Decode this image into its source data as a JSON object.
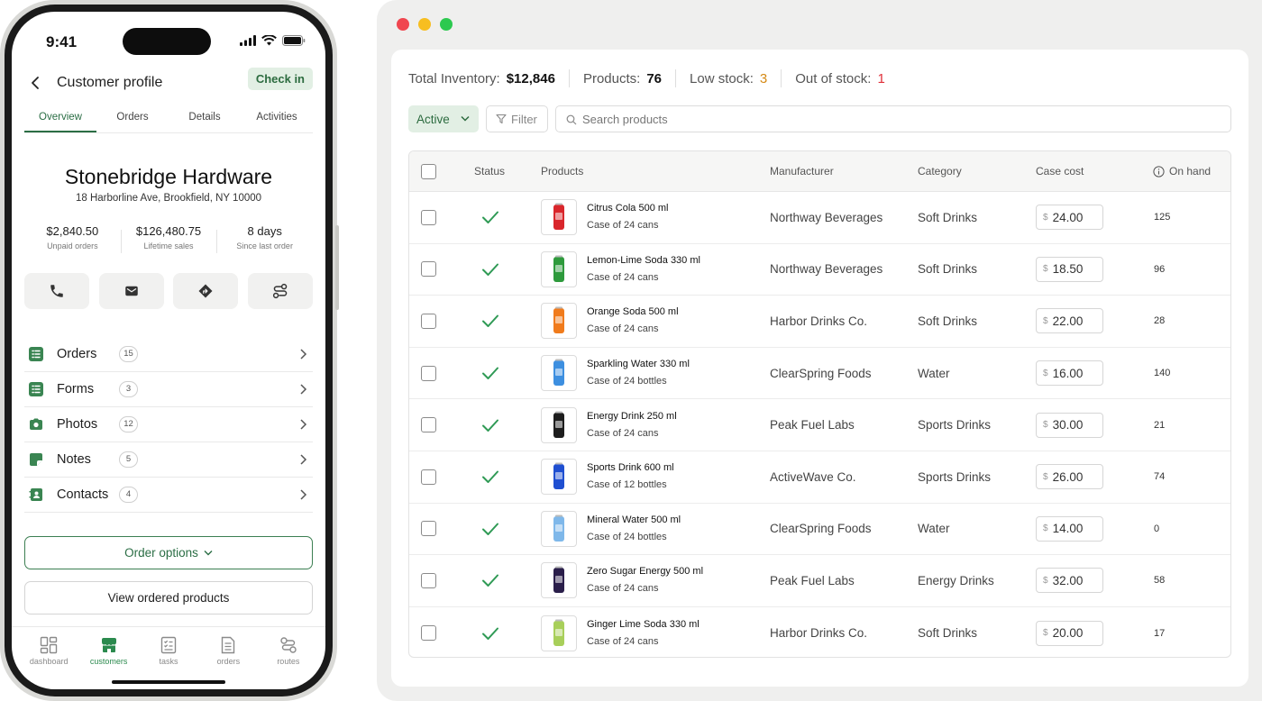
{
  "phone": {
    "status_time": "9:41",
    "header": {
      "title": "Customer profile",
      "checkin_label": "Check in"
    },
    "tabs": [
      "Overview",
      "Orders",
      "Details",
      "Activities"
    ],
    "active_tab": "Overview",
    "company": {
      "name": "Stonebridge Hardware",
      "address": "18 Harborline Ave, Brookfield, NY 10000"
    },
    "stats": [
      {
        "value": "$2,840.50",
        "label": "Unpaid orders"
      },
      {
        "value": "$126,480.75",
        "label": "Lifetime sales"
      },
      {
        "value": "8 days",
        "label": "Since last order"
      }
    ],
    "quick_actions": [
      "phone-icon",
      "mail-icon",
      "directions-icon",
      "route-icon"
    ],
    "menu": [
      {
        "label": "Orders",
        "count": "15",
        "icon": "orders-list-icon"
      },
      {
        "label": "Forms",
        "count": "3",
        "icon": "forms-list-icon"
      },
      {
        "label": "Photos",
        "count": "12",
        "icon": "camera-icon"
      },
      {
        "label": "Notes",
        "count": "5",
        "icon": "note-icon"
      },
      {
        "label": "Contacts",
        "count": "4",
        "icon": "contact-card-icon"
      }
    ],
    "order_options_label": "Order options",
    "view_ordered_label": "View ordered products",
    "bottom_nav": [
      {
        "label": "dashboard",
        "icon": "dashboard-icon"
      },
      {
        "label": "customers",
        "icon": "store-icon"
      },
      {
        "label": "tasks",
        "icon": "tasks-icon"
      },
      {
        "label": "orders",
        "icon": "orders-icon"
      },
      {
        "label": "routes",
        "icon": "routes-icon"
      }
    ],
    "active_nav": "customers",
    "accent": "#2b6e45"
  },
  "inventory": {
    "summary": {
      "total_label": "Total Inventory:",
      "total_value": "$12,846",
      "products_label": "Products:",
      "products_value": "76",
      "low_label": "Low stock:",
      "low_value": "3",
      "out_label": "Out of stock:",
      "out_value": "1"
    },
    "status_filter": "Active",
    "filter_label": "Filter",
    "search_placeholder": "Search products",
    "columns": [
      "Status",
      "Products",
      "Manufacturer",
      "Category",
      "Case cost",
      "On hand"
    ],
    "currency_symbol": "$",
    "rows": [
      {
        "name": "Citrus Cola 500 ml",
        "pack": "Case of 24 cans",
        "manufacturer": "Northway Beverages",
        "category": "Soft Drinks",
        "cost": "24.00",
        "on_hand": "125",
        "thumb_color": "#d9262b"
      },
      {
        "name": "Lemon-Lime Soda 330 ml",
        "pack": "Case of 24 cans",
        "manufacturer": "Northway Beverages",
        "category": "Soft Drinks",
        "cost": "18.50",
        "on_hand": "96",
        "thumb_color": "#2e9a3c"
      },
      {
        "name": "Orange Soda 500 ml",
        "pack": "Case of 24 cans",
        "manufacturer": "Harbor Drinks Co.",
        "category": "Soft Drinks",
        "cost": "22.00",
        "on_hand": "28",
        "thumb_color": "#f07b1c"
      },
      {
        "name": "Sparkling Water 330 ml",
        "pack": "Case of 24 bottles",
        "manufacturer": "ClearSpring Foods",
        "category": "Water",
        "cost": "16.00",
        "on_hand": "140",
        "thumb_color": "#3d8fe0"
      },
      {
        "name": "Energy Drink 250 ml",
        "pack": "Case of 24 cans",
        "manufacturer": "Peak Fuel Labs",
        "category": "Sports Drinks",
        "cost": "30.00",
        "on_hand": "21",
        "thumb_color": "#1d1d1d"
      },
      {
        "name": "Sports Drink 600 ml",
        "pack": "Case of 12 bottles",
        "manufacturer": "ActiveWave Co.",
        "category": "Sports Drinks",
        "cost": "26.00",
        "on_hand": "74",
        "thumb_color": "#1f4fd1"
      },
      {
        "name": "Mineral Water 500 ml",
        "pack": "Case of 24 bottles",
        "manufacturer": "ClearSpring Foods",
        "category": "Water",
        "cost": "14.00",
        "on_hand": "0",
        "thumb_color": "#7fb8ea"
      },
      {
        "name": "Zero Sugar Energy 500 ml",
        "pack": "Case of 24 cans",
        "manufacturer": "Peak Fuel Labs",
        "category": "Energy Drinks",
        "cost": "32.00",
        "on_hand": "58",
        "thumb_color": "#2a1e4a"
      },
      {
        "name": "Ginger Lime Soda 330 ml",
        "pack": "Case of 24 cans",
        "manufacturer": "Harbor Drinks Co.",
        "category": "Soft Drinks",
        "cost": "20.00",
        "on_hand": "17",
        "thumb_color": "#a8cf5a"
      }
    ],
    "colors": {
      "check": "#2f9a55",
      "low_stock": "#d58a16",
      "out_of_stock": "#e0303a"
    }
  }
}
